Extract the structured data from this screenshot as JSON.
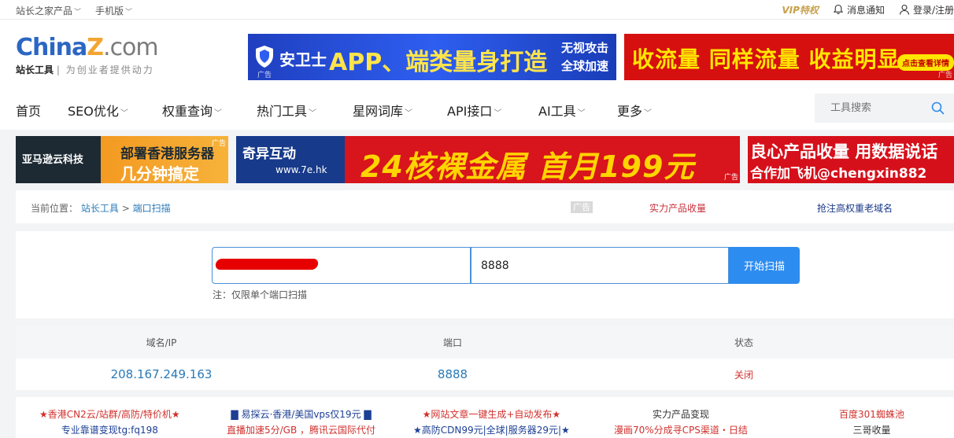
{
  "topbar": {
    "products": "站长之家产品",
    "mobile": "手机版",
    "vip": "VIP特权",
    "notify": "消息通知",
    "login": "登录/注册"
  },
  "logo": {
    "brand_a": "China",
    "brand_b": "Z",
    "brand_c": ".com",
    "tag_name": "站长工具",
    "tag_slogan": "| 为创业者提供动力"
  },
  "header_ads": {
    "ad1": {
      "brand": "安卫士",
      "main": "APP、端类量身打造",
      "side_line1": "无视攻击",
      "side_line2": "全球加速",
      "mark": "广告"
    },
    "ad2": {
      "text": "收流量 同样流量 收益明显",
      "button": "点击查看详情",
      "mark": "广告"
    }
  },
  "nav": {
    "items": [
      {
        "label": "首页",
        "chev": false
      },
      {
        "label": "SEO优化",
        "chev": true
      },
      {
        "label": "权重查询",
        "chev": true
      },
      {
        "label": "热门工具",
        "chev": true
      },
      {
        "label": "星网词库",
        "chev": true
      },
      {
        "label": "API接口",
        "chev": true
      },
      {
        "label": "AI工具",
        "chev": true
      },
      {
        "label": "更多",
        "chev": true
      }
    ],
    "search_placeholder": "工具搜索"
  },
  "banner_ads": {
    "a": {
      "left": "亚马逊云科技",
      "line1": "部署香港服务器",
      "line2": "几分钟搞定",
      "mark": "广告"
    },
    "b": {
      "logo": "奇异互动",
      "url": "www.7e.hk",
      "big": "24核裸金属 首月199元",
      "mark": "广告"
    },
    "c": {
      "line1": "良心产品收量 用数据说话",
      "line2": "合作加飞机@chengxin882"
    }
  },
  "breadcrumb": {
    "prefix": "当前位置：",
    "home": "站长工具",
    "sep": ">",
    "current": "端口扫描",
    "ad_tag": "广告",
    "promo1": "实力产品收量",
    "promo2": "抢注高权重老域名"
  },
  "query": {
    "port_value": "8888",
    "button": "开始扫描",
    "note": "注：仅限单个端口扫描"
  },
  "result": {
    "headers": [
      "域名/IP",
      "端口",
      "状态"
    ],
    "row": {
      "ip": "208.167.249.163",
      "port": "8888",
      "status": "关闭"
    }
  },
  "text_ads": [
    {
      "line1": "★香港CN2云/站群/高防/特价机★",
      "line2": "专业靠谱变现tg:fq198"
    },
    {
      "line1": "▇ 易探云·香港/美国vps仅19元 ▇",
      "line2": "直播加速5分/GB ，腾讯云国际代付"
    },
    {
      "line1": "★网站文章一键生成+自动发布★",
      "line2": "★高防CDN99元|全球|服务器29元|★"
    },
    {
      "line1": "实力产品变现",
      "line2": "漫画70%分成寻CPS渠道・日结"
    },
    {
      "line1": "百度301蜘蛛池",
      "line2": "三哥收量"
    }
  ]
}
